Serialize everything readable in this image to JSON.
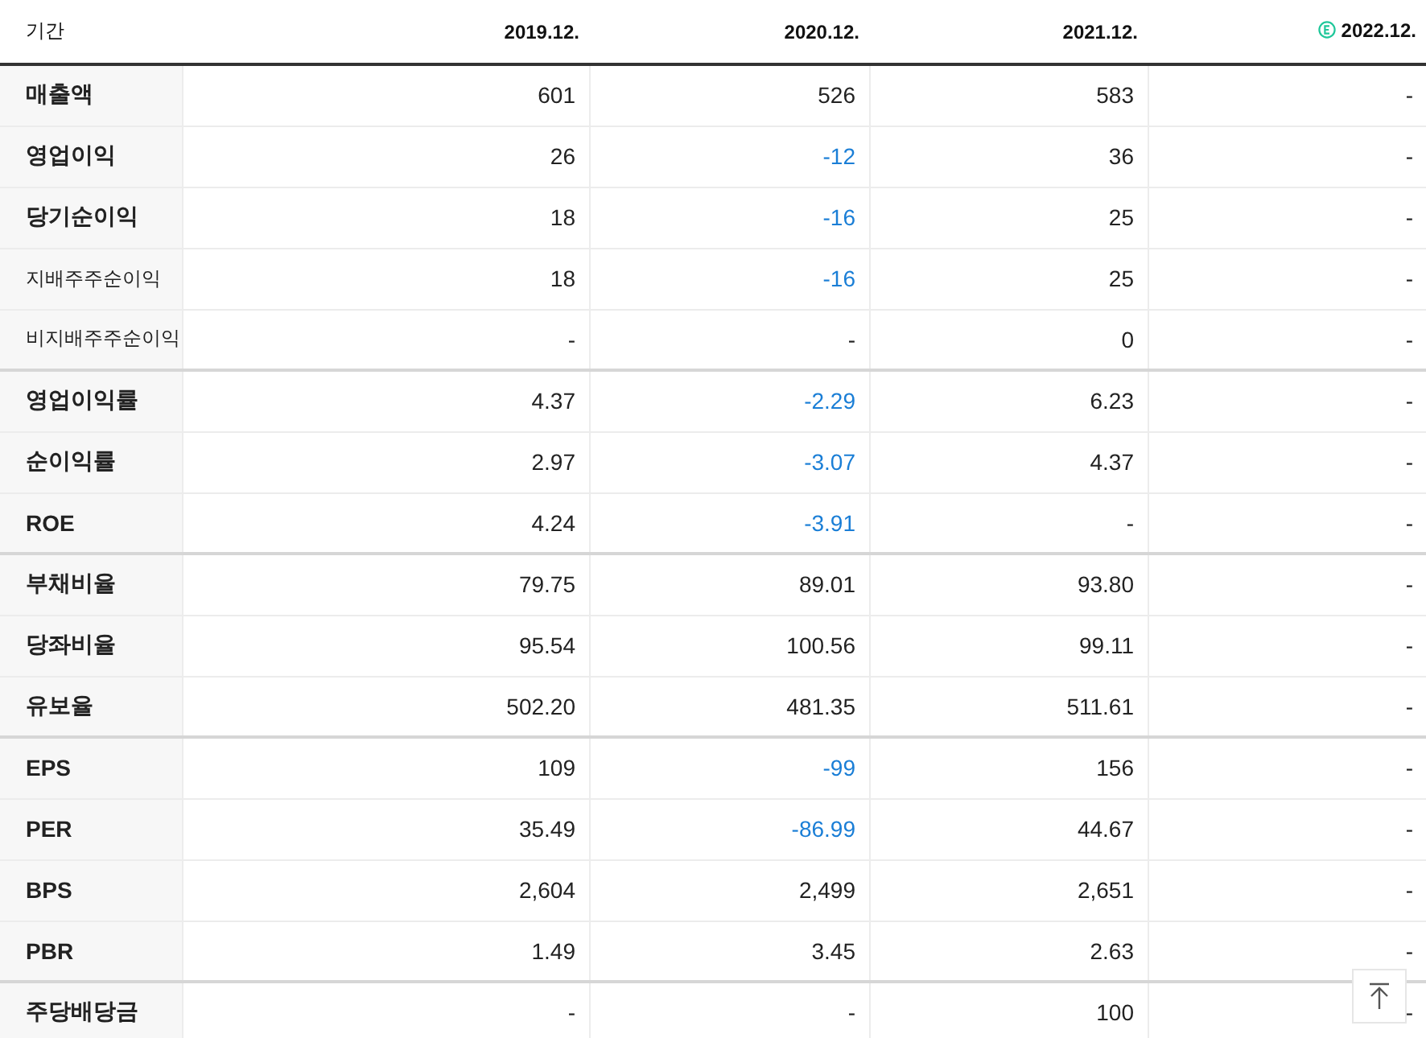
{
  "table": {
    "label_header": "기간",
    "columns": [
      {
        "label": "2019.12.",
        "estimate": false
      },
      {
        "label": "2020.12.",
        "estimate": false
      },
      {
        "label": "2021.12.",
        "estimate": false
      },
      {
        "label": "2022.12.",
        "estimate": true
      }
    ],
    "rows": [
      {
        "label": "매출액",
        "kind": "main",
        "group_start": false,
        "cells": [
          "601",
          "526",
          "583",
          "-"
        ],
        "negative": [
          false,
          false,
          false,
          false
        ]
      },
      {
        "label": "영업이익",
        "kind": "main",
        "group_start": false,
        "cells": [
          "26",
          "-12",
          "36",
          "-"
        ],
        "negative": [
          false,
          true,
          false,
          false
        ]
      },
      {
        "label": "당기순이익",
        "kind": "main",
        "group_start": false,
        "cells": [
          "18",
          "-16",
          "25",
          "-"
        ],
        "negative": [
          false,
          true,
          false,
          false
        ]
      },
      {
        "label": "지배주주순이익",
        "kind": "sub",
        "group_start": false,
        "cells": [
          "18",
          "-16",
          "25",
          "-"
        ],
        "negative": [
          false,
          true,
          false,
          false
        ]
      },
      {
        "label": "비지배주주순이익",
        "kind": "sub",
        "group_start": false,
        "cells": [
          "-",
          "-",
          "0",
          "-"
        ],
        "negative": [
          false,
          false,
          false,
          false
        ]
      },
      {
        "label": "영업이익률",
        "kind": "main",
        "group_start": true,
        "cells": [
          "4.37",
          "-2.29",
          "6.23",
          "-"
        ],
        "negative": [
          false,
          true,
          false,
          false
        ]
      },
      {
        "label": "순이익률",
        "kind": "main",
        "group_start": false,
        "cells": [
          "2.97",
          "-3.07",
          "4.37",
          "-"
        ],
        "negative": [
          false,
          true,
          false,
          false
        ]
      },
      {
        "label": "ROE",
        "kind": "main",
        "group_start": false,
        "cells": [
          "4.24",
          "-3.91",
          "-",
          "-"
        ],
        "negative": [
          false,
          true,
          false,
          false
        ]
      },
      {
        "label": "부채비율",
        "kind": "main",
        "group_start": true,
        "cells": [
          "79.75",
          "89.01",
          "93.80",
          "-"
        ],
        "negative": [
          false,
          false,
          false,
          false
        ]
      },
      {
        "label": "당좌비율",
        "kind": "main",
        "group_start": false,
        "cells": [
          "95.54",
          "100.56",
          "99.11",
          "-"
        ],
        "negative": [
          false,
          false,
          false,
          false
        ]
      },
      {
        "label": "유보율",
        "kind": "main",
        "group_start": false,
        "cells": [
          "502.20",
          "481.35",
          "511.61",
          "-"
        ],
        "negative": [
          false,
          false,
          false,
          false
        ]
      },
      {
        "label": "EPS",
        "kind": "main",
        "group_start": true,
        "cells": [
          "109",
          "-99",
          "156",
          "-"
        ],
        "negative": [
          false,
          true,
          false,
          false
        ]
      },
      {
        "label": "PER",
        "kind": "main",
        "group_start": false,
        "cells": [
          "35.49",
          "-86.99",
          "44.67",
          "-"
        ],
        "negative": [
          false,
          true,
          false,
          false
        ]
      },
      {
        "label": "BPS",
        "kind": "main",
        "group_start": false,
        "cells": [
          "2,604",
          "2,499",
          "2,651",
          "-"
        ],
        "negative": [
          false,
          false,
          false,
          false
        ]
      },
      {
        "label": "PBR",
        "kind": "main",
        "group_start": false,
        "cells": [
          "1.49",
          "3.45",
          "2.63",
          "-"
        ],
        "negative": [
          false,
          false,
          false,
          false
        ]
      },
      {
        "label": "주당배당금",
        "kind": "main",
        "group_start": true,
        "cells": [
          "-",
          "-",
          "100",
          "-"
        ],
        "negative": [
          false,
          false,
          false,
          false
        ]
      }
    ]
  },
  "scroll_top_button": {
    "visible": true
  }
}
